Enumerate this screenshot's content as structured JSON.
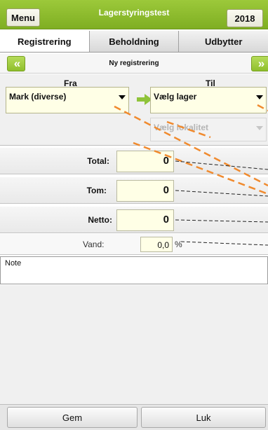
{
  "header": {
    "menu_label": "Menu",
    "title": "Lagerstyringstest",
    "year_label": "2018"
  },
  "tabs": [
    {
      "label": "Registrering",
      "active": true
    },
    {
      "label": "Beholdning",
      "active": false
    },
    {
      "label": "Udbytter",
      "active": false
    }
  ],
  "nav": {
    "prev_icon": "double-chevron-left-icon",
    "next_icon": "double-chevron-right-icon",
    "prev_glyph": "«",
    "next_glyph": "»",
    "title": "Ny registrering"
  },
  "transfer": {
    "from_label": "Fra",
    "to_label": "Til",
    "from_value": "Mark (diverse)",
    "to_value": "Vælg lager",
    "location_placeholder": "Vælg lokalitet"
  },
  "weights": {
    "total_label": "Total:",
    "total_value": "0",
    "tom_label": "Tom:",
    "tom_value": "0",
    "netto_label": "Netto:",
    "netto_value": "0",
    "vand_label": "Vand:",
    "vand_value": "0,0",
    "vand_unit": "%"
  },
  "note": {
    "label": "Note"
  },
  "footer": {
    "save_label": "Gem",
    "close_label": "Luk"
  },
  "colors": {
    "accent_green": "#8fbf2c",
    "input_bg": "#ffffe6",
    "annotation_orange": "#f08a2e"
  }
}
